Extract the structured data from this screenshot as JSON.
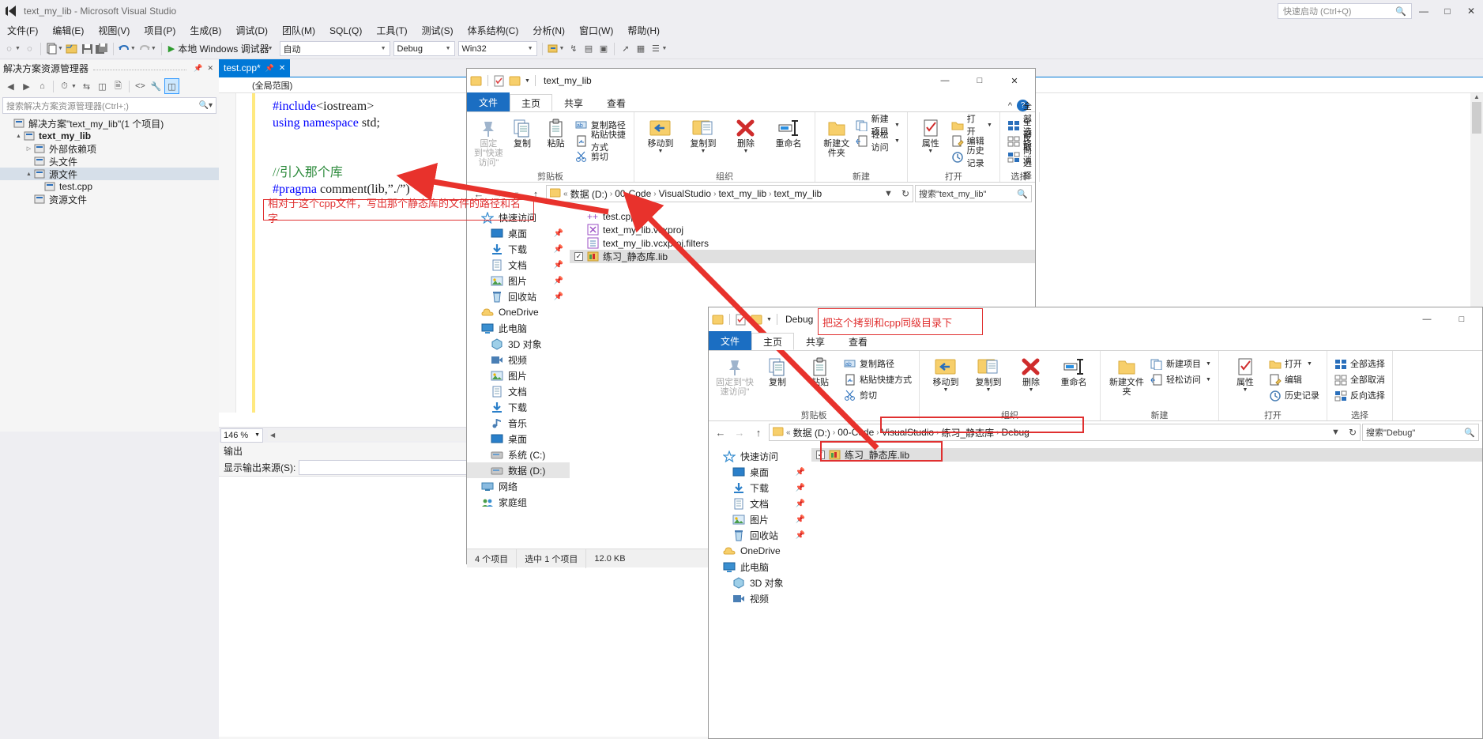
{
  "vs": {
    "title": "text_my_lib - Microsoft Visual Studio",
    "quick_launch_placeholder": "快速启动 (Ctrl+Q)",
    "window_buttons": [
      "—",
      "□",
      "✕"
    ],
    "menus": [
      "文件(F)",
      "编辑(E)",
      "视图(V)",
      "项目(P)",
      "生成(B)",
      "调试(D)",
      "团队(M)",
      "SQL(Q)",
      "工具(T)",
      "测试(S)",
      "体系结构(C)",
      "分析(N)",
      "窗口(W)",
      "帮助(H)"
    ],
    "toolbar": {
      "run_label": "本地 Windows 调试器",
      "config": "自动",
      "build_config": "Debug",
      "platform": "Win32"
    },
    "solution_explorer": {
      "header": "解决方案资源管理器",
      "search_placeholder": "搜索解决方案资源管理器(Ctrl+;)",
      "tree": [
        {
          "label": "解决方案\"text_my_lib\"(1 个项目)",
          "indent": 0,
          "twisty": "",
          "icon": "solution-icon",
          "bold": false,
          "selected": false
        },
        {
          "label": "text_my_lib",
          "indent": 1,
          "twisty": "▲",
          "icon": "project-icon",
          "bold": true,
          "selected": false
        },
        {
          "label": "外部依赖项",
          "indent": 2,
          "twisty": "▷",
          "icon": "folder-filter-icon",
          "bold": false,
          "selected": false
        },
        {
          "label": "头文件",
          "indent": 2,
          "twisty": "",
          "icon": "folder-filter-icon",
          "bold": false,
          "selected": false
        },
        {
          "label": "源文件",
          "indent": 2,
          "twisty": "▲",
          "icon": "folder-filter-icon",
          "bold": false,
          "selected": true
        },
        {
          "label": "test.cpp",
          "indent": 3,
          "twisty": "",
          "icon": "cpp-file-icon",
          "bold": false,
          "selected": false
        },
        {
          "label": "资源文件",
          "indent": 2,
          "twisty": "",
          "icon": "folder-filter-icon",
          "bold": false,
          "selected": false
        }
      ]
    },
    "editor": {
      "tab_label": "test.cpp*",
      "scope": "(全局范围)",
      "code_lines": [
        {
          "parts": [
            {
              "t": "#include",
              "c": "pl"
            },
            {
              "t": "<iostream>",
              "c": "txt"
            }
          ]
        },
        {
          "parts": [
            {
              "t": "using namespace",
              "c": "kw"
            },
            {
              "t": " std;",
              "c": "txt"
            }
          ]
        },
        {
          "parts": [
            {
              "t": "",
              "c": "txt"
            }
          ]
        },
        {
          "parts": [
            {
              "t": "",
              "c": "txt"
            }
          ]
        },
        {
          "parts": [
            {
              "t": "//引入那个库",
              "c": "cmt"
            }
          ]
        },
        {
          "parts": [
            {
              "t": "#pragma",
              "c": "pl"
            },
            {
              "t": " comment(lib,",
              "c": "txt"
            },
            {
              "t": "”./”",
              "c": "txt"
            },
            {
              "t": ")",
              "c": "txt"
            }
          ]
        }
      ],
      "zoom": "146 %"
    },
    "output": {
      "title": "输出",
      "source_label": "显示输出来源(S):"
    }
  },
  "explorer1": {
    "title": "text_my_lib",
    "window_buttons": [
      "—",
      "□",
      "✕"
    ],
    "tabs": [
      {
        "label": "文件",
        "type": "file"
      },
      {
        "label": "主页",
        "type": "active"
      },
      {
        "label": "共享",
        "type": "normal"
      },
      {
        "label": "查看",
        "type": "normal"
      }
    ],
    "help_icon": "?",
    "collapse_icon": "^",
    "ribbon": [
      {
        "name": "剪贴板",
        "big": [
          {
            "label": "固定到\"快速访问\"",
            "icon": "pin-icon",
            "disabled": true
          },
          {
            "label": "复制",
            "icon": "copy-icon",
            "disabled": false
          },
          {
            "label": "粘贴",
            "icon": "paste-icon",
            "disabled": false
          }
        ],
        "small": [
          {
            "label": "复制路径",
            "icon": "copy-path-icon"
          },
          {
            "label": "粘贴快捷方式",
            "icon": "paste-shortcut-icon"
          },
          {
            "label": "剪切",
            "icon": "cut-icon"
          }
        ]
      },
      {
        "name": "组织",
        "big": [
          {
            "label": "移动到",
            "icon": "move-to-icon",
            "dropdown": true
          },
          {
            "label": "复制到",
            "icon": "copy-to-icon",
            "dropdown": true
          },
          {
            "label": "删除",
            "icon": "delete-icon",
            "dropdown": true
          },
          {
            "label": "重命名",
            "icon": "rename-icon",
            "dropdown": false
          }
        ],
        "small": []
      },
      {
        "name": "新建",
        "big": [
          {
            "label": "新建文件夹",
            "icon": "new-folder-icon",
            "disabled": false
          }
        ],
        "small": [
          {
            "label": "新建项目",
            "icon": "new-item-icon",
            "caret": true
          },
          {
            "label": "轻松访问",
            "icon": "easy-access-icon",
            "caret": true
          }
        ]
      },
      {
        "name": "打开",
        "big": [
          {
            "label": "属性",
            "icon": "properties-icon",
            "dropdown": true
          }
        ],
        "small": [
          {
            "label": "打开",
            "icon": "open-icon",
            "caret": true
          },
          {
            "label": "编辑",
            "icon": "edit-icon"
          },
          {
            "label": "历史记录",
            "icon": "history-icon"
          }
        ]
      },
      {
        "name": "选择",
        "big": [],
        "small": [
          {
            "label": "全部选择",
            "icon": "select-all-icon"
          },
          {
            "label": "全部取消",
            "icon": "select-none-icon"
          },
          {
            "label": "反向选择",
            "icon": "invert-selection-icon"
          }
        ]
      }
    ],
    "breadcrumbs": [
      "数据 (D:)",
      "00-Code",
      "VisualStudio",
      "text_my_lib",
      "text_my_lib"
    ],
    "search_placeholder": "搜索\"text_my_lib\"",
    "nav_items": [
      {
        "label": "快速访问",
        "icon": "star-icon",
        "indent": 0,
        "pin": false
      },
      {
        "label": "桌面",
        "icon": "desktop-icon",
        "indent": 1,
        "pin": true
      },
      {
        "label": "下载",
        "icon": "download-icon",
        "indent": 1,
        "pin": true
      },
      {
        "label": "文档",
        "icon": "documents-icon",
        "indent": 1,
        "pin": true
      },
      {
        "label": "图片",
        "icon": "pictures-icon",
        "indent": 1,
        "pin": true
      },
      {
        "label": "回收站",
        "icon": "recycle-bin-icon",
        "indent": 1,
        "pin": true
      },
      {
        "label": "OneDrive",
        "icon": "onedrive-icon",
        "indent": 0,
        "pin": false
      },
      {
        "label": "此电脑",
        "icon": "this-pc-icon",
        "indent": 0,
        "pin": false
      },
      {
        "label": "3D 对象",
        "icon": "3d-objects-icon",
        "indent": 1,
        "pin": false
      },
      {
        "label": "视频",
        "icon": "videos-icon",
        "indent": 1,
        "pin": false
      },
      {
        "label": "图片",
        "icon": "pictures-icon",
        "indent": 1,
        "pin": false
      },
      {
        "label": "文档",
        "icon": "documents-icon",
        "indent": 1,
        "pin": false
      },
      {
        "label": "下载",
        "icon": "download-icon",
        "indent": 1,
        "pin": false
      },
      {
        "label": "音乐",
        "icon": "music-icon",
        "indent": 1,
        "pin": false
      },
      {
        "label": "桌面",
        "icon": "desktop-icon",
        "indent": 1,
        "pin": false
      },
      {
        "label": "系统 (C:)",
        "icon": "drive-icon",
        "indent": 1,
        "pin": false
      },
      {
        "label": "数据 (D:)",
        "icon": "drive-icon",
        "indent": 1,
        "pin": false,
        "selected": true
      },
      {
        "label": "网络",
        "icon": "network-icon",
        "indent": 0,
        "pin": false
      },
      {
        "label": "家庭组",
        "icon": "homegroup-icon",
        "indent": 0,
        "pin": false
      }
    ],
    "files": [
      {
        "name": "test.cpp",
        "icon": "cpp-file-icon",
        "checked": false,
        "selected": false
      },
      {
        "name": "text_my_lib.vcxproj",
        "icon": "vcxproj-icon",
        "checked": false,
        "selected": false
      },
      {
        "name": "text_my_lib.vcxproj.filters",
        "icon": "filters-icon",
        "checked": false,
        "selected": false
      },
      {
        "name": "练习_静态库.lib",
        "icon": "lib-file-icon",
        "checked": true,
        "selected": true
      }
    ],
    "status": {
      "count": "4 个项目",
      "selection": "选中 1 个项目",
      "size": "12.0 KB"
    }
  },
  "explorer2": {
    "title": "Debug",
    "window_buttons": [
      "—",
      "□"
    ],
    "tabs": [
      {
        "label": "文件",
        "type": "file"
      },
      {
        "label": "主页",
        "type": "active"
      },
      {
        "label": "共享",
        "type": "normal"
      },
      {
        "label": "查看",
        "type": "normal"
      }
    ],
    "ribbon": [
      {
        "name": "剪贴板",
        "big": [
          {
            "label": "固定到\"快速访问\"",
            "icon": "pin-icon",
            "disabled": true
          },
          {
            "label": "复制",
            "icon": "copy-icon",
            "disabled": false
          },
          {
            "label": "粘贴",
            "icon": "paste-icon",
            "disabled": false
          }
        ],
        "small": [
          {
            "label": "复制路径",
            "icon": "copy-path-icon"
          },
          {
            "label": "粘贴快捷方式",
            "icon": "paste-shortcut-icon"
          },
          {
            "label": "剪切",
            "icon": "cut-icon"
          }
        ]
      },
      {
        "name": "组织",
        "big": [
          {
            "label": "移动到",
            "icon": "move-to-icon",
            "dropdown": true
          },
          {
            "label": "复制到",
            "icon": "copy-to-icon",
            "dropdown": true
          },
          {
            "label": "删除",
            "icon": "delete-icon",
            "dropdown": true
          },
          {
            "label": "重命名",
            "icon": "rename-icon",
            "dropdown": false
          }
        ],
        "small": []
      },
      {
        "name": "新建",
        "big": [
          {
            "label": "新建文件夹",
            "icon": "new-folder-icon",
            "disabled": false
          }
        ],
        "small": [
          {
            "label": "新建项目",
            "icon": "new-item-icon",
            "caret": true
          },
          {
            "label": "轻松访问",
            "icon": "easy-access-icon",
            "caret": true
          }
        ]
      },
      {
        "name": "打开",
        "big": [
          {
            "label": "属性",
            "icon": "properties-icon",
            "dropdown": true
          }
        ],
        "small": [
          {
            "label": "打开",
            "icon": "open-icon",
            "caret": true
          },
          {
            "label": "编辑",
            "icon": "edit-icon"
          },
          {
            "label": "历史记录",
            "icon": "history-icon"
          }
        ]
      },
      {
        "name": "选择",
        "big": [],
        "small": [
          {
            "label": "全部选择",
            "icon": "select-all-icon"
          },
          {
            "label": "全部取消",
            "icon": "select-none-icon"
          },
          {
            "label": "反向选择",
            "icon": "invert-selection-icon"
          }
        ]
      }
    ],
    "breadcrumbs": [
      "数据 (D:)",
      "00-Code",
      "VisualStudio",
      "练习_静态库",
      "Debug"
    ],
    "search_placeholder": "搜索\"Debug\"",
    "nav_items": [
      {
        "label": "快速访问",
        "icon": "star-icon",
        "indent": 0,
        "pin": false
      },
      {
        "label": "桌面",
        "icon": "desktop-icon",
        "indent": 1,
        "pin": true
      },
      {
        "label": "下载",
        "icon": "download-icon",
        "indent": 1,
        "pin": true
      },
      {
        "label": "文档",
        "icon": "documents-icon",
        "indent": 1,
        "pin": true
      },
      {
        "label": "图片",
        "icon": "pictures-icon",
        "indent": 1,
        "pin": true
      },
      {
        "label": "回收站",
        "icon": "recycle-bin-icon",
        "indent": 1,
        "pin": true
      },
      {
        "label": "OneDrive",
        "icon": "onedrive-icon",
        "indent": 0,
        "pin": false
      },
      {
        "label": "此电脑",
        "icon": "this-pc-icon",
        "indent": 0,
        "pin": false
      },
      {
        "label": "3D 对象",
        "icon": "3d-objects-icon",
        "indent": 1,
        "pin": false
      },
      {
        "label": "视频",
        "icon": "videos-icon",
        "indent": 1,
        "pin": false
      }
    ],
    "files": [
      {
        "name": "练习_静态库.lib",
        "icon": "lib-file-icon",
        "checked": true,
        "selected": true
      }
    ]
  },
  "annotations": {
    "code_note": "相对于这个cpp文件，写出那个静态库的文件的路径和名字",
    "copy_note": "把这个拷到和cpp同级目录下",
    "accent_color": "#e03030"
  }
}
